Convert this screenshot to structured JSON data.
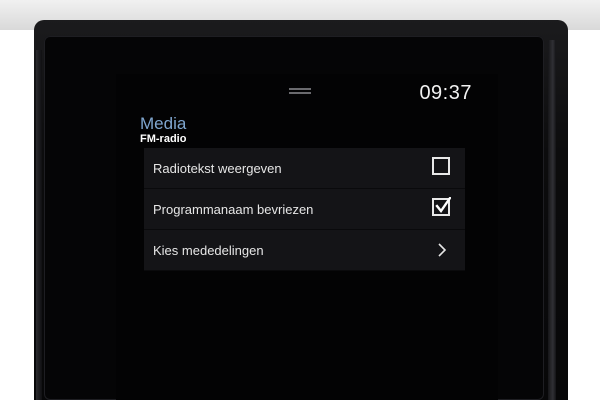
{
  "status_bar": {
    "time": "09:37"
  },
  "header": {
    "title": "Media",
    "subtitle": "FM-radio"
  },
  "settings": {
    "items": [
      {
        "label": "Radiotekst weergeven",
        "control": "checkbox",
        "checked": false
      },
      {
        "label": "Programmanaam bevriezen",
        "control": "checkbox",
        "checked": true
      },
      {
        "label": "Kies mededelingen",
        "control": "chevron-right-icon"
      }
    ]
  },
  "colors": {
    "title": "#7fa6cf",
    "row_background": "#141417",
    "screen_background": "#030304"
  }
}
